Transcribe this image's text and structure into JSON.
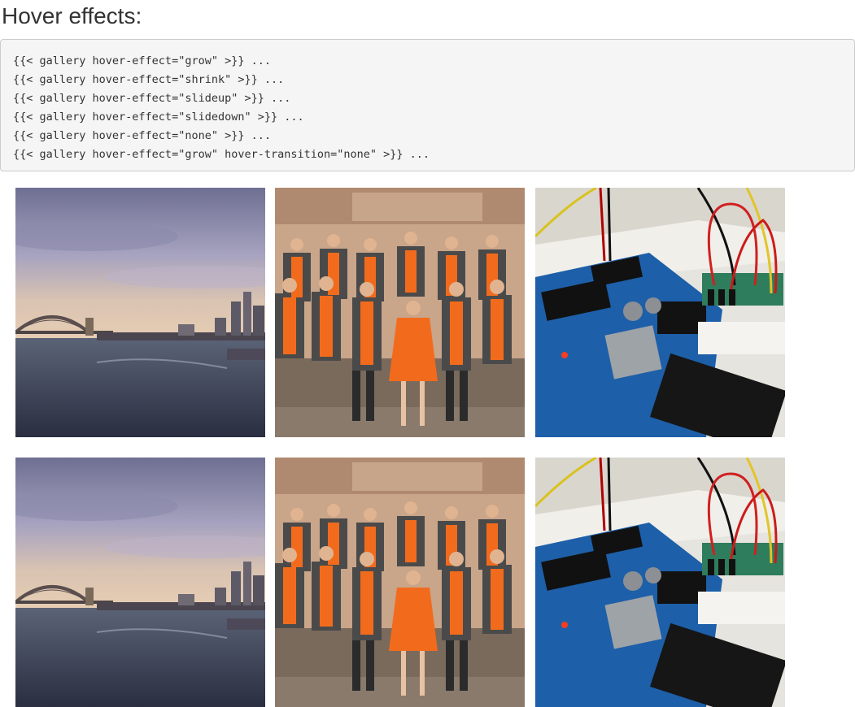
{
  "page": {
    "title": "Hover effects:"
  },
  "code_example": {
    "lines": [
      "{{< gallery hover-effect=\"grow\" >}} ...",
      "{{< gallery hover-effect=\"shrink\" >}} ...",
      "{{< gallery hover-effect=\"slideup\" >}} ...",
      "{{< gallery hover-effect=\"slidedown\" >}} ...",
      "{{< gallery hover-effect=\"none\" >}} ...",
      "{{< gallery hover-effect=\"grow\" hover-transition=\"none\" >}} ..."
    ]
  },
  "gallery": {
    "images": [
      {
        "subject": "harbour-bridge-skyline",
        "row": 1
      },
      {
        "subject": "choir-in-orange",
        "row": 1
      },
      {
        "subject": "arduino-breadboard",
        "row": 1
      },
      {
        "subject": "harbour-bridge-skyline",
        "row": 2
      },
      {
        "subject": "choir-in-orange",
        "row": 2
      },
      {
        "subject": "arduino-breadboard",
        "row": 2
      }
    ]
  },
  "colors": {
    "code_background": "#f5f5f5",
    "code_border": "#cccccc",
    "text": "#333333",
    "choir_shirt": "#f26b1d",
    "suit": "#4a4a4a",
    "board_blue": "#1d5fa8"
  }
}
